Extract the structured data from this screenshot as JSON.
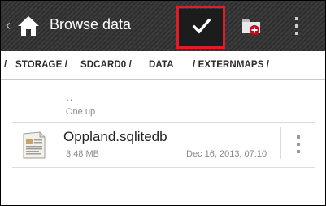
{
  "action_bar": {
    "up_caret": "‹",
    "title": "Browse data",
    "icons": [
      "home-icon",
      "checkmark-icon",
      "new-folder-icon",
      "overflow-menu-icon"
    ]
  },
  "breadcrumb": {
    "lead": "/",
    "segments": [
      "STORAGE /",
      "SDCARD0 /",
      "DATA",
      "/ EXTERNMAPS /"
    ]
  },
  "list": {
    "up_item": {
      "glyph": "..",
      "label": "One up"
    },
    "files": [
      {
        "name": "Oppland.sqlitedb",
        "size": "3.48 MB",
        "date": "Dec 16, 2013, 07:10",
        "icon": "database-file-icon"
      }
    ]
  },
  "colors": {
    "action_bar": "#323232",
    "highlight": "#e01d26",
    "folder_badge": "#d0021b"
  }
}
